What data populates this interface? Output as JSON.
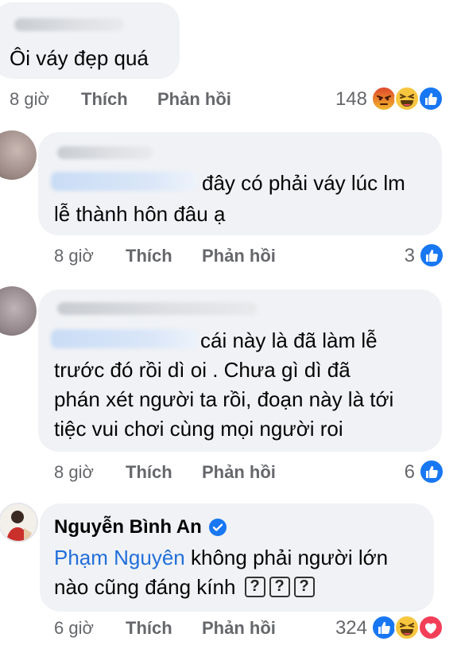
{
  "comments": [
    {
      "text": "Ôi váy đẹp quá",
      "time": "8 giờ",
      "like_label": "Thích",
      "reply_label": "Phản hồi",
      "reaction_count": "148",
      "reactions": [
        "angry-icon",
        "haha-icon",
        "like-icon"
      ]
    },
    {
      "text_line1": "đây có phải váy lúc lm",
      "text_line2": "lễ thành hôn đâu ạ",
      "time": "8 giờ",
      "like_label": "Thích",
      "reply_label": "Phản hồi",
      "reaction_count": "3",
      "reactions": [
        "like-icon"
      ]
    },
    {
      "text_line1": "cái này là đã làm lễ",
      "text_line2": "trước đó rồi dì oi . Chưa gì dì đã",
      "text_line3": "phán xét người ta rồi, đoạn này là tới",
      "text_line4": "tiệc vui chơi cùng mọi người roi",
      "time": "8 giờ",
      "like_label": "Thích",
      "reply_label": "Phản hồi",
      "reaction_count": "6",
      "reactions": [
        "like-icon"
      ]
    },
    {
      "author": "Nguyễn Bình An",
      "verified": true,
      "mention": "Phạm Nguyên",
      "text_line1": "không phải người lớn",
      "text_line2": "nào cũng đáng kính",
      "emoji_boxes": [
        "?",
        "?",
        "?"
      ],
      "time": "6 giờ",
      "like_label": "Thích",
      "reply_label": "Phản hồi",
      "reaction_count": "324",
      "reactions": [
        "like-icon",
        "haha-icon",
        "love-icon"
      ]
    }
  ],
  "colors": {
    "bubble": "#f0f2f5",
    "meta_text": "#65676b",
    "mention": "#216fdb",
    "like_blue": "#1877f2",
    "love_red": "#f33e58",
    "angry_orange": "#e9710f"
  }
}
